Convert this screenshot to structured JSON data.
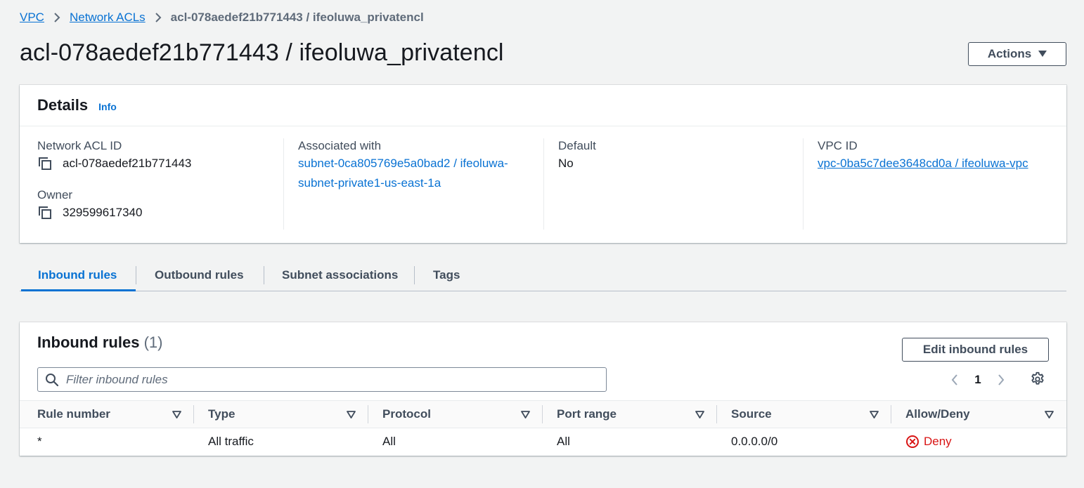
{
  "breadcrumb": {
    "items": [
      "VPC",
      "Network ACLs"
    ],
    "current": "acl-078aedef21b771443 / ifeoluwa_privatencl"
  },
  "page": {
    "title": "acl-078aedef21b771443 / ifeoluwa_privatencl",
    "actions_label": "Actions"
  },
  "details": {
    "title": "Details",
    "info_label": "Info",
    "network_acl_id_label": "Network ACL ID",
    "network_acl_id": "acl-078aedef21b771443",
    "owner_label": "Owner",
    "owner": "329599617340",
    "associated_label": "Associated with",
    "associated_value": "subnet-0ca805769e5a0bad2 / ifeoluwa-subnet-private1-us-east-1a",
    "default_label": "Default",
    "default_value": "No",
    "vpc_id_label": "VPC ID",
    "vpc_id_value": "vpc-0ba5c7dee3648cd0a / ifeoluwa-vpc"
  },
  "tabs": [
    {
      "label": "Inbound rules",
      "active": true
    },
    {
      "label": "Outbound rules",
      "active": false
    },
    {
      "label": "Subnet associations",
      "active": false
    },
    {
      "label": "Tags",
      "active": false
    }
  ],
  "rules": {
    "title": "Inbound rules",
    "count": "(1)",
    "edit_label": "Edit inbound rules",
    "filter_placeholder": "Filter inbound rules",
    "page_number": "1",
    "columns": [
      "Rule number",
      "Type",
      "Protocol",
      "Port range",
      "Source",
      "Allow/Deny"
    ],
    "rows": [
      {
        "rule_number": "*",
        "type": "All traffic",
        "protocol": "All",
        "port_range": "All",
        "source": "0.0.0.0/0",
        "action": "Deny"
      }
    ]
  },
  "colors": {
    "link": "#0972d3",
    "deny": "#d91515",
    "background": "#f2f3f3"
  }
}
